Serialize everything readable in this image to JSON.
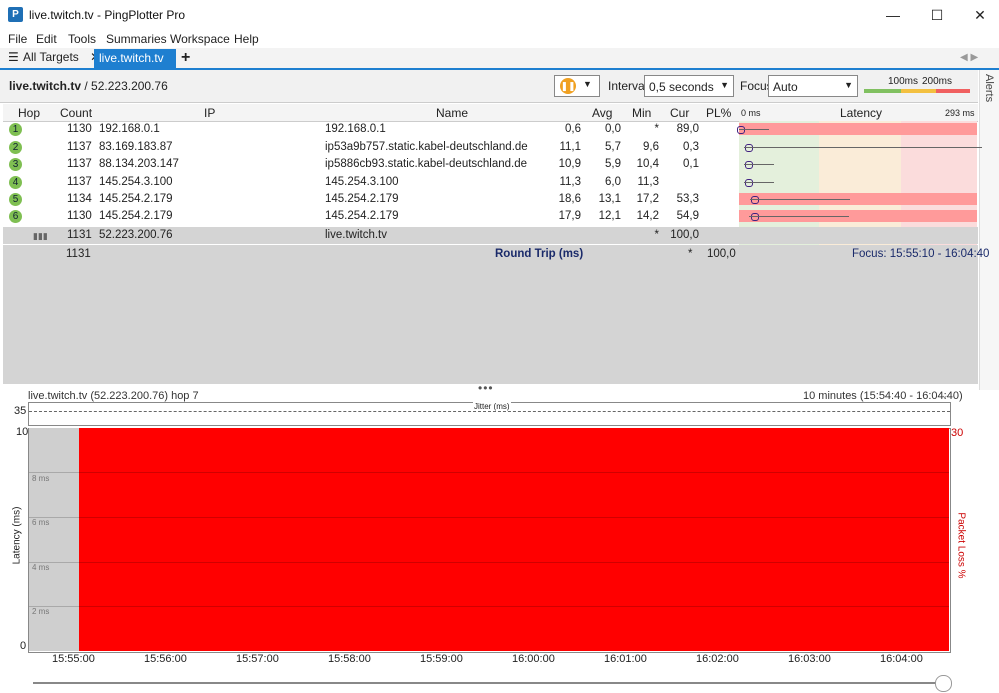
{
  "window": {
    "title": "live.twitch.tv - PingPlotter Pro",
    "minimize": "—",
    "maximize": "☐",
    "close": "✕"
  },
  "menu": [
    "File",
    "Edit",
    "Tools",
    "Summaries",
    "Workspace",
    "Help"
  ],
  "tabs": {
    "all": "All Targets",
    "active": "live.twitch.tv",
    "add": "+"
  },
  "target": {
    "host": "live.twitch.tv",
    "ip": " / 52.223.200.76",
    "interval_label": "Interval",
    "interval_value": "0,5 seconds",
    "focus_label": "Focus",
    "focus_value": "Auto",
    "scale_100": "100ms",
    "scale_200": "200ms",
    "alerts": "Alerts"
  },
  "table": {
    "headers": {
      "hop": "Hop",
      "count": "Count",
      "ip": "IP",
      "name": "Name",
      "avg": "Avg",
      "min": "Min",
      "cur": "Cur",
      "pl": "PL%",
      "latency": "Latency",
      "lat_min": "0 ms",
      "lat_max": "293 ms"
    },
    "rows": [
      {
        "hop": "1",
        "count": "1130",
        "ip": "192.168.0.1",
        "name": "192.168.0.1",
        "avg": "0,6",
        "min": "0,0",
        "cur": "*",
        "pl": "89,0"
      },
      {
        "hop": "2",
        "count": "1137",
        "ip": "83.169.183.87",
        "name": "ip53a9b757.static.kabel-deutschland.de",
        "avg": "11,1",
        "min": "5,7",
        "cur": "9,6",
        "pl": "0,3"
      },
      {
        "hop": "3",
        "count": "1137",
        "ip": "88.134.203.147",
        "name": "ip5886cb93.static.kabel-deutschland.de",
        "avg": "10,9",
        "min": "5,9",
        "cur": "10,4",
        "pl": "0,1"
      },
      {
        "hop": "4",
        "count": "1137",
        "ip": "145.254.3.100",
        "name": "145.254.3.100",
        "avg": "11,3",
        "min": "6,0",
        "cur": "11,3",
        "pl": ""
      },
      {
        "hop": "5",
        "count": "1134",
        "ip": "145.254.2.179",
        "name": "145.254.2.179",
        "avg": "18,6",
        "min": "13,1",
        "cur": "17,2",
        "pl": "53,3"
      },
      {
        "hop": "6",
        "count": "1130",
        "ip": "145.254.2.179",
        "name": "145.254.2.179",
        "avg": "17,9",
        "min": "12,1",
        "cur": "14,2",
        "pl": "54,9"
      },
      {
        "hop": "",
        "count": "1131",
        "ip": "52.223.200.76",
        "name": "live.twitch.tv",
        "avg": "",
        "min": "",
        "cur": "*",
        "pl": "100,0"
      }
    ],
    "summary": {
      "count": "1131",
      "label": "Round Trip (ms)",
      "cur": "*",
      "pl": "100,0",
      "focus": "Focus: 15:55:10 - 16:04:40"
    }
  },
  "graph": {
    "title": "live.twitch.tv (52.223.200.76) hop 7",
    "range": "10 minutes (15:54:40 - 16:04:40)",
    "jitter_label": "Jitter (ms)",
    "jitter_max": "35",
    "y_max": "10",
    "y_min": "0",
    "y_label": "Latency (ms)",
    "right_max": "30",
    "right_label": "Packet Loss %",
    "grid_labels": [
      "8 ms",
      "6 ms",
      "4 ms",
      "2 ms"
    ],
    "x_ticks": [
      "15:55:00",
      "15:56:00",
      "15:57:00",
      "15:58:00",
      "15:59:00",
      "16:00:00",
      "16:01:00",
      "16:02:00",
      "16:03:00",
      "16:04:00"
    ],
    "packet_loss_color": "#ff0000"
  }
}
